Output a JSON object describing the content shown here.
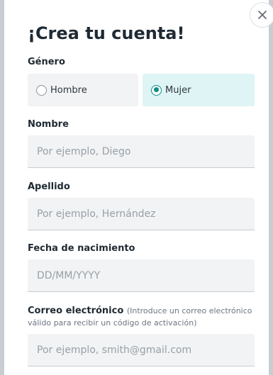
{
  "dialog": {
    "title": "¡Crea tu cuenta!",
    "close_icon": "×"
  },
  "gender": {
    "label": "Género",
    "options": [
      {
        "label": "Hombre",
        "checked": false
      },
      {
        "label": "Mujer",
        "checked": true
      }
    ]
  },
  "first_name": {
    "label": "Nombre",
    "placeholder": "Por ejemplo, Diego",
    "value": ""
  },
  "last_name": {
    "label": "Apellido",
    "placeholder": "Por ejemplo, Hernández",
    "value": ""
  },
  "birth_date": {
    "label": "Fecha de nacimiento",
    "placeholder": "DD/MM/YYYY",
    "value": ""
  },
  "email": {
    "label": "Correo electrónico",
    "hint_line1": "(Introduce un correo electrónico",
    "hint_line2": "válido para recibir un código de activación)",
    "placeholder": "Por ejemplo, smith@gmail.com",
    "value": ""
  },
  "colors": {
    "accent": "#0f8c86",
    "selected_bg": "#dff4f4",
    "field_bg": "#f1f3f4"
  }
}
